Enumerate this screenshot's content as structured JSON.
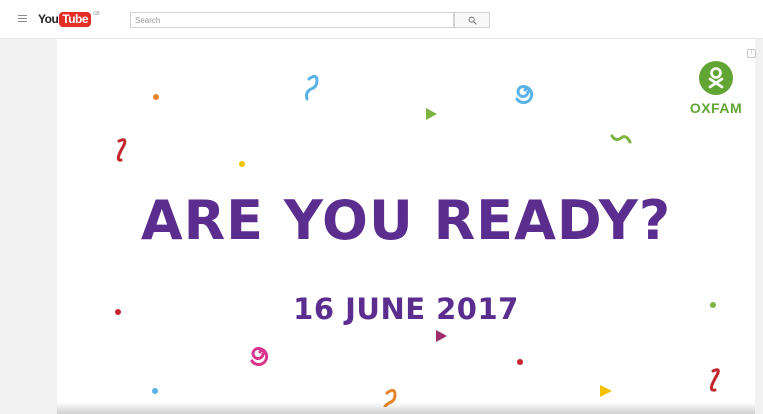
{
  "masthead": {
    "logo_you": "You",
    "logo_tube": "Tube",
    "logo_region": "GB",
    "search_placeholder": "Search"
  },
  "icons": {
    "menu": "hamburger-menu-icon",
    "search": "magnifier-icon",
    "info": "info-icon",
    "brand": "oxfam-logo-icon"
  },
  "video": {
    "headline": "ARE YOU READY?",
    "date": "16 JUNE 2017",
    "oxfam_label": "OXFAM"
  },
  "colors": {
    "headline_purple": "#5b2d8e",
    "oxfam_green": "#61a534",
    "youtube_red": "#e52d27",
    "confetti_blue": "#5ab3e6",
    "confetti_orange": "#e8842c",
    "confetti_red": "#c4262e",
    "confetti_pink": "#d8358c",
    "confetti_yellow": "#f2c100",
    "confetti_green": "#7cb342"
  }
}
